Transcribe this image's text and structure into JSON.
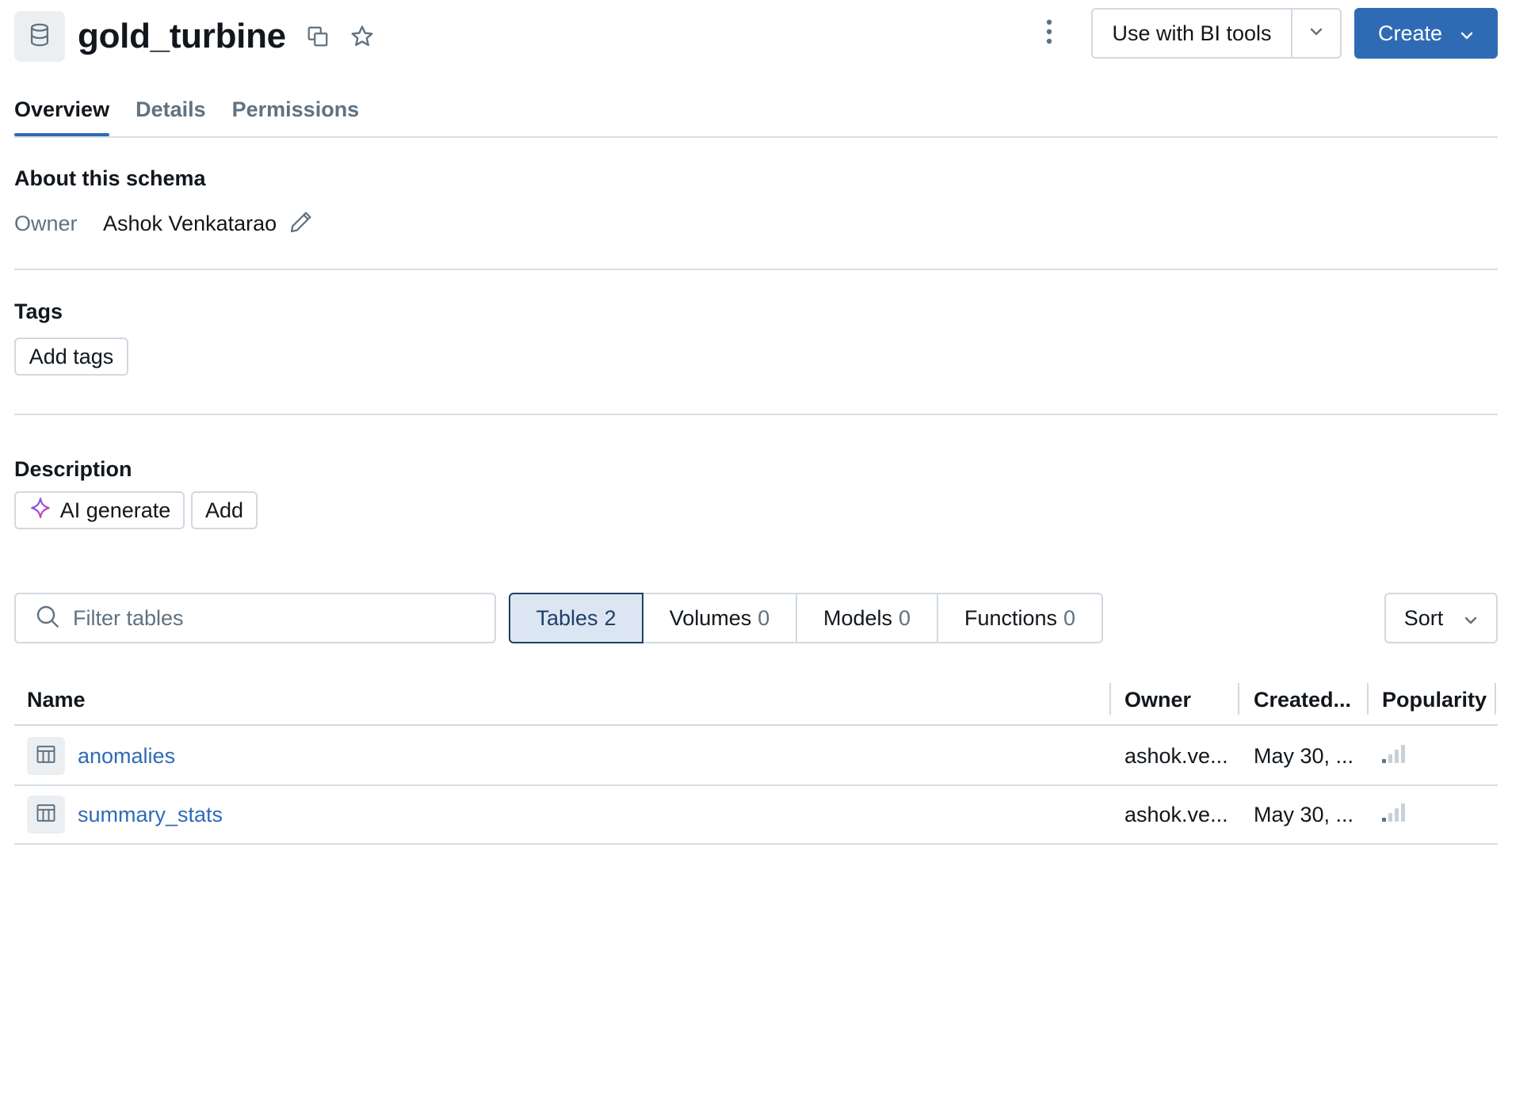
{
  "header": {
    "title": "gold_turbine",
    "use_bi_label": "Use with BI tools",
    "create_label": "Create"
  },
  "tabs": [
    {
      "label": "Overview",
      "active": true
    },
    {
      "label": "Details",
      "active": false
    },
    {
      "label": "Permissions",
      "active": false
    }
  ],
  "about": {
    "heading": "About this schema",
    "owner_label": "Owner",
    "owner_value": "Ashok Venkatarao"
  },
  "tags": {
    "heading": "Tags",
    "add_label": "Add tags"
  },
  "description": {
    "heading": "Description",
    "ai_label": "AI generate",
    "add_label": "Add"
  },
  "filter": {
    "placeholder": "Filter tables",
    "segments": [
      {
        "label": "Tables",
        "count": "2",
        "active": true
      },
      {
        "label": "Volumes",
        "count": "0",
        "active": false
      },
      {
        "label": "Models",
        "count": "0",
        "active": false
      },
      {
        "label": "Functions",
        "count": "0",
        "active": false
      }
    ],
    "sort_label": "Sort"
  },
  "table": {
    "columns": [
      "Name",
      "Owner",
      "Created...",
      "Popularity"
    ],
    "rows": [
      {
        "name": "anomalies",
        "owner": "ashok.ve...",
        "created": "May 30, ...",
        "popularity": 1
      },
      {
        "name": "summary_stats",
        "owner": "ashok.ve...",
        "created": "May 30, ...",
        "popularity": 1
      }
    ]
  },
  "colors": {
    "accent": "#2f6bb5",
    "active_segment_bg": "#dce6f2",
    "muted_text": "#5f7281",
    "border": "#d1d9e1"
  },
  "icons": {
    "schema": "database-icon",
    "copy": "copy-icon",
    "star": "star-icon",
    "kebab": "kebab-menu-icon",
    "edit": "pencil-icon",
    "ai": "sparkle-icon",
    "search": "search-icon",
    "table": "table-icon",
    "popularity": "signal-bars-icon"
  }
}
